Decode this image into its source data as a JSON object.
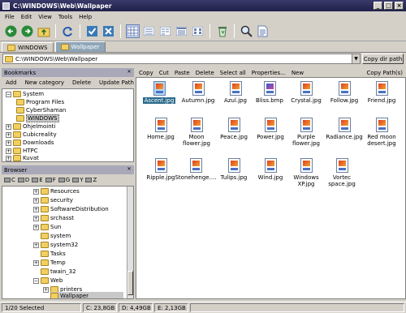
{
  "window": {
    "title": "C:\\WINDOWS\\Web\\Wallpaper",
    "min": "_",
    "max": "□",
    "close": "×"
  },
  "menu": [
    "File",
    "Edit",
    "View",
    "Tools",
    "Help"
  ],
  "tabs": [
    {
      "label": "WINDOWS"
    },
    {
      "label": "Wallpaper"
    }
  ],
  "address": {
    "path": "C:\\WINDOWS\\Web\\Wallpaper",
    "copy_label": "Copy dir path"
  },
  "bookmarks": {
    "title": "Bookmarks",
    "actions": [
      "Add",
      "New category",
      "Delete",
      "Update Path"
    ],
    "items": [
      "System",
      "Program Files",
      "CyberShaman",
      "WINDOWS",
      "Ohjelmointi",
      "Cubicreality",
      "Downloads",
      "HTPC",
      "Kuvat"
    ]
  },
  "browser": {
    "title": "Browser",
    "drives": [
      "C",
      "D",
      "E",
      "F",
      "G",
      "Y",
      "Z"
    ],
    "items": [
      "Resources",
      "security",
      "SoftwareDistribution",
      "srchasst",
      "Sun",
      "system",
      "system32",
      "Tasks",
      "Temp",
      "twain_32",
      "Web",
      "printers",
      "Wallpaper"
    ]
  },
  "file_actions": [
    "Copy",
    "Cut",
    "Paste",
    "Delete",
    "Select all",
    "Properties...",
    "New"
  ],
  "copy_paths_label": "Copy Path(s)",
  "files": [
    {
      "name": "Ascent.jpg",
      "type": "jpg"
    },
    {
      "name": "Autumn.jpg",
      "type": "jpg"
    },
    {
      "name": "Azul.jpg",
      "type": "jpg"
    },
    {
      "name": "Bliss.bmp",
      "type": "bmp"
    },
    {
      "name": "Crystal.jpg",
      "type": "jpg"
    },
    {
      "name": "Follow.jpg",
      "type": "jpg"
    },
    {
      "name": "Friend.jpg",
      "type": "jpg"
    },
    {
      "name": "Home.jpg",
      "type": "jpg"
    },
    {
      "name": "Moon flower.jpg",
      "type": "jpg"
    },
    {
      "name": "Peace.jpg",
      "type": "jpg"
    },
    {
      "name": "Power.jpg",
      "type": "jpg"
    },
    {
      "name": "Purple flower.jpg",
      "type": "jpg"
    },
    {
      "name": "Radiance.jpg",
      "type": "jpg"
    },
    {
      "name": "Red moon desert.jpg",
      "type": "jpg"
    },
    {
      "name": "Ripple.jpg",
      "type": "jpg"
    },
    {
      "name": "Stonehenge....",
      "type": "jpg"
    },
    {
      "name": "Tulips.jpg",
      "type": "jpg"
    },
    {
      "name": "Wind.jpg",
      "type": "jpg"
    },
    {
      "name": "Windows XP.jpg",
      "type": "jpg"
    },
    {
      "name": "Vortec space.jpg",
      "type": "jpg"
    }
  ],
  "status": {
    "selected": "1/20 Selected",
    "c": "C: 23,8GB",
    "d": "D: 4,49GB",
    "e": "E: 2,13GB"
  },
  "colors": {
    "title_bar": "#2a2a5a",
    "selected_tab": "#8fa6b8",
    "file_selection": "#2a6a8a"
  }
}
